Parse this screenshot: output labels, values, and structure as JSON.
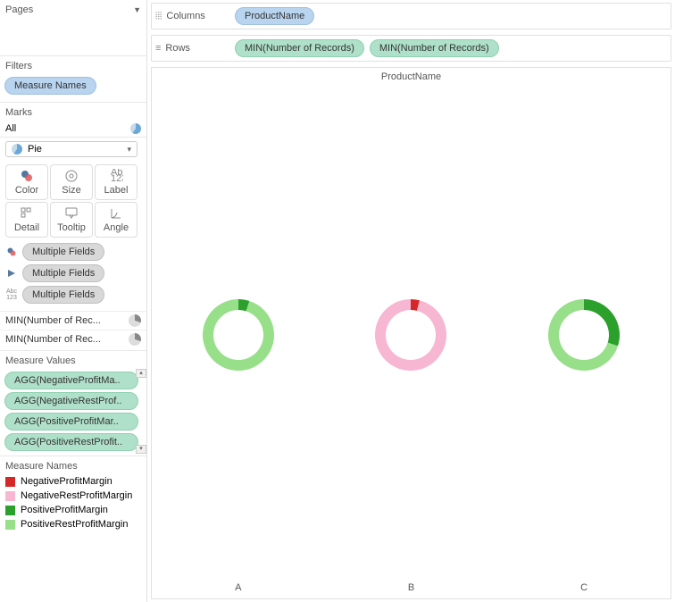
{
  "sidebar": {
    "pages": {
      "title": "Pages"
    },
    "filters": {
      "title": "Filters",
      "items": [
        "Measure Names"
      ]
    },
    "marks": {
      "title": "Marks",
      "all_label": "All",
      "type_label": "Pie",
      "buttons": [
        "Color",
        "Size",
        "Label",
        "Detail",
        "Tooltip",
        "Angle"
      ],
      "pills": [
        "Multiple Fields",
        "Multiple Fields",
        "Multiple Fields"
      ],
      "axes": [
        "MIN(Number of Rec...",
        "MIN(Number of Rec..."
      ]
    },
    "measure_values": {
      "title": "Measure Values",
      "items": [
        "AGG(NegativeProfitMa..",
        "AGG(NegativeRestProf..",
        "AGG(PositiveProfitMar..",
        "AGG(PositiveRestProfit.."
      ]
    },
    "measure_names": {
      "title": "Measure Names",
      "items": [
        {
          "label": "NegativeProfitMargin",
          "color": "#d62728"
        },
        {
          "label": "NegativeRestProfitMargin",
          "color": "#f7b6d2"
        },
        {
          "label": "PositiveProfitMargin",
          "color": "#2ca02c"
        },
        {
          "label": "PositiveRestProfitMargin",
          "color": "#98df8a"
        }
      ]
    }
  },
  "shelves": {
    "columns_label": "Columns",
    "rows_label": "Rows",
    "columns": [
      "ProductName"
    ],
    "rows": [
      "MIN(Number of Records)",
      "MIN(Number of Records)"
    ]
  },
  "chart": {
    "title": "ProductName",
    "categories": [
      "A",
      "B",
      "C"
    ]
  },
  "chart_data": {
    "type": "pie",
    "title": "ProductName",
    "categories": [
      "A",
      "B",
      "C"
    ],
    "series_colors": {
      "NegativeProfitMargin": "#d62728",
      "NegativeRestProfitMargin": "#f7b6d2",
      "PositiveProfitMargin": "#2ca02c",
      "PositiveRestProfitMargin": "#98df8a"
    },
    "donuts": [
      {
        "product": "A",
        "slices": [
          {
            "name": "PositiveProfitMargin",
            "value": 5
          },
          {
            "name": "PositiveRestProfitMargin",
            "value": 95
          }
        ]
      },
      {
        "product": "B",
        "slices": [
          {
            "name": "NegativeProfitMargin",
            "value": 4
          },
          {
            "name": "NegativeRestProfitMargin",
            "value": 96
          }
        ]
      },
      {
        "product": "C",
        "slices": [
          {
            "name": "PositiveProfitMargin",
            "value": 30
          },
          {
            "name": "PositiveRestProfitMargin",
            "value": 70
          }
        ]
      }
    ]
  }
}
